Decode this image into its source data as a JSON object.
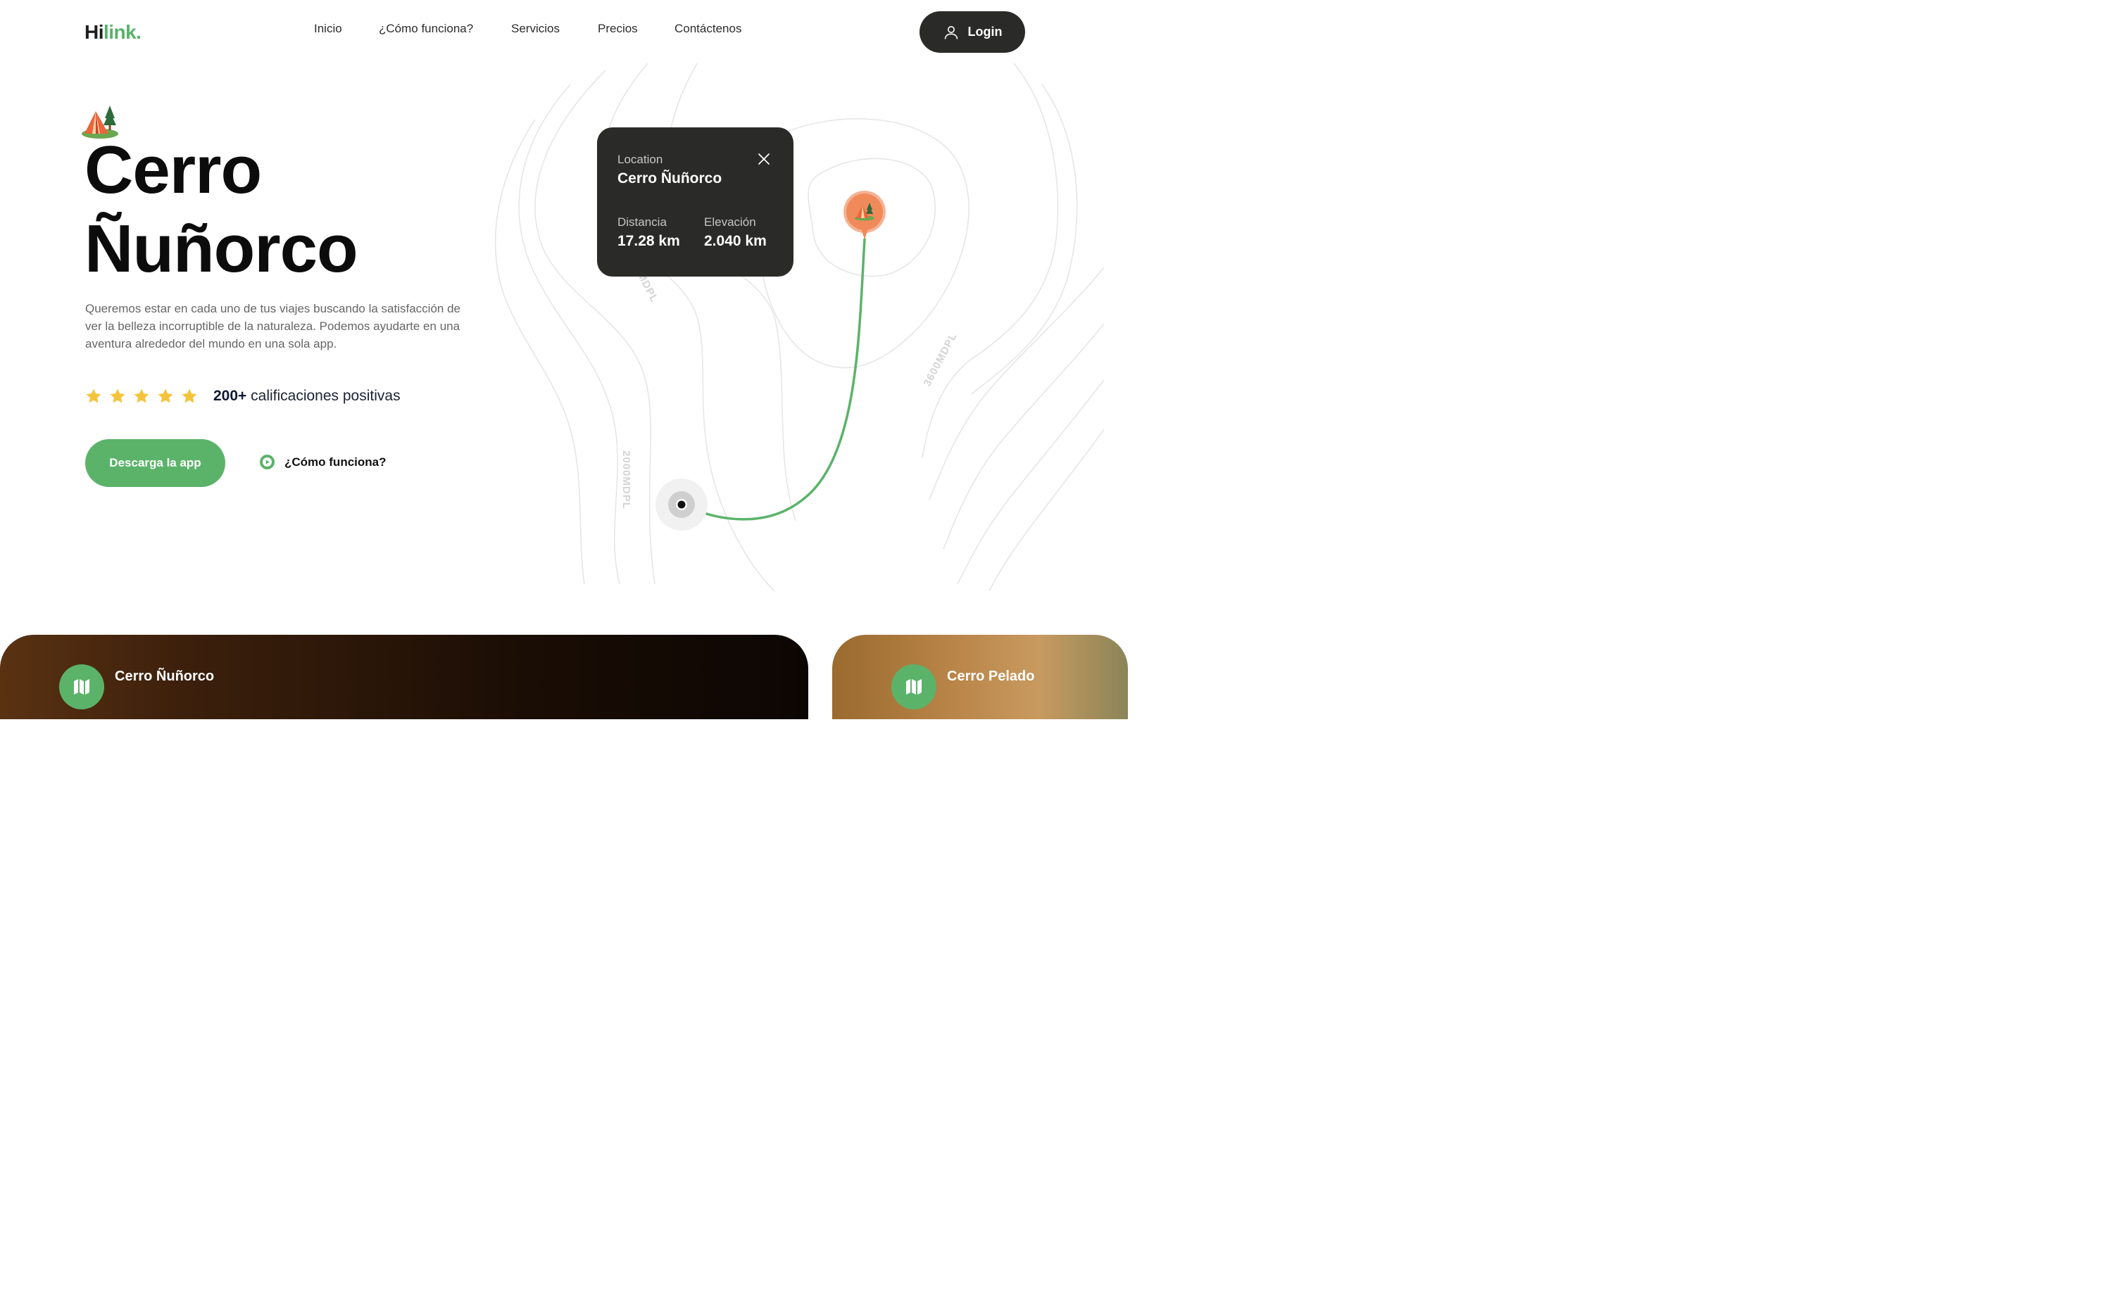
{
  "header": {
    "logo_part1": "Hi",
    "logo_part2": "link.",
    "nav": [
      "Inicio",
      "¿Cómo funciona?",
      "Servicios",
      "Precios",
      "Contáctenos"
    ],
    "login_label": "Login"
  },
  "hero": {
    "title_line1": "Cerro",
    "title_line2": "Ñuñorco",
    "description": "Queremos estar en cada uno de tus viajes buscando la satisfacción de ver la belleza incorruptible de la naturaleza. Podemos ayudarte en una aventura alrededor del mundo en una sola app.",
    "rating_stars": 5,
    "rating_count": "200+",
    "rating_text": " calificaciones positivas",
    "download_label": "Descarga la app",
    "how_label": "¿Cómo funciona?"
  },
  "map": {
    "contour_labels": [
      "2000MDPL",
      "3600MDPL",
      "MDPL"
    ],
    "route_color": "#5bb36a",
    "pin_color": "#f08a5a"
  },
  "location_card": {
    "label": "Location",
    "name": "Cerro Ñuñorco",
    "distance_label": "Distancia",
    "distance_value": "17.28 km",
    "elevation_label": "Elevación",
    "elevation_value": "2.040 km"
  },
  "cards": [
    {
      "title": "Cerro Ñuñorco",
      "icon": "map-icon"
    },
    {
      "title": "Cerro Pelado",
      "icon": "map-icon"
    }
  ],
  "colors": {
    "accent": "#5bb36a",
    "dark": "#2a2b28",
    "star": "#f5c33b"
  }
}
